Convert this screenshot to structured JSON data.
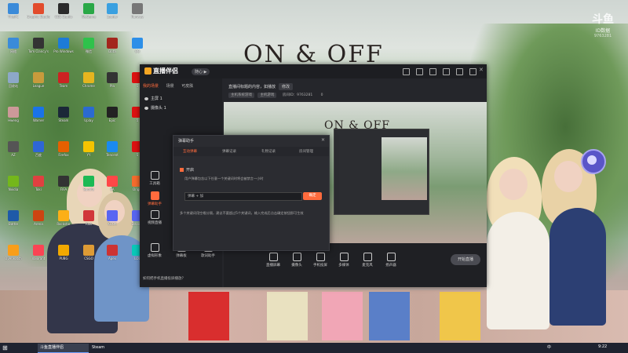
{
  "stream_logo": {
    "name": "斗鱼",
    "line2": "ID数据",
    "line3": "9763281"
  },
  "wallpaper": {
    "title": "ON & OFF"
  },
  "desktop_icons": [
    {
      "label": "ThisPC",
      "color": "#3b8bd9"
    },
    {
      "label": "Graphic Studio",
      "color": "#e24c2c"
    },
    {
      "label": "OBS Studio",
      "color": "#2b2b2b"
    },
    {
      "label": "WeGame",
      "color": "#2aa847"
    },
    {
      "label": "Loader",
      "color": "#3aa0e0"
    },
    {
      "label": "Runway",
      "color": "#777"
    },
    {
      "label": "网络",
      "color": "#3b8bd9"
    },
    {
      "label": "Tom Clancy's",
      "color": "#333"
    },
    {
      "label": "Pro Windows",
      "color": "#1d7bd6"
    },
    {
      "label": "微信",
      "color": "#2fc24b"
    },
    {
      "label": "Dota",
      "color": "#a3261d"
    },
    {
      "label": "QQ",
      "color": "#2d8fe8"
    },
    {
      "label": "回收站",
      "color": "#8da8c8"
    },
    {
      "label": "League",
      "color": "#c89b3c"
    },
    {
      "label": "Team",
      "color": "#c22"
    },
    {
      "label": "Chrome",
      "color": "#e5b51f"
    },
    {
      "label": "Pla",
      "color": "#333"
    },
    {
      "label": "5",
      "color": "#d11"
    },
    {
      "label": "Hweng",
      "color": "#c99"
    },
    {
      "label": "Warner",
      "color": "#1a73e8"
    },
    {
      "label": "Steam",
      "color": "#1b2838"
    },
    {
      "label": "Uplay",
      "color": "#2b6ad1"
    },
    {
      "label": "Epic",
      "color": "#222"
    },
    {
      "label": "5",
      "color": "#d11"
    },
    {
      "label": "AZ",
      "color": "#555"
    },
    {
      "label": "百度",
      "color": "#2e66d6"
    },
    {
      "label": "Firefox",
      "color": "#e66000"
    },
    {
      "label": "YY",
      "color": "#f5c400"
    },
    {
      "label": "Tencent",
      "color": "#1a8af0"
    },
    {
      "label": "5",
      "color": "#d11"
    },
    {
      "label": "Nvidia",
      "color": "#74b71b"
    },
    {
      "label": "Toki",
      "color": "#e04040"
    },
    {
      "label": "FIFA",
      "color": "#333"
    },
    {
      "label": "Spotify",
      "color": "#1db954"
    },
    {
      "label": "EA",
      "color": "#ff4747"
    },
    {
      "label": "Origin",
      "color": "#f56c2d"
    },
    {
      "label": "Battle",
      "color": "#1e5aa8"
    },
    {
      "label": "Arena",
      "color": "#c41"
    },
    {
      "label": "Rockstar",
      "color": "#fcaf17"
    },
    {
      "label": "Riot",
      "color": "#d13639"
    },
    {
      "label": "KOOK",
      "color": "#5865f2"
    },
    {
      "label": "Discord",
      "color": "#5865f2"
    },
    {
      "label": "Overwatch",
      "color": "#f99e1a"
    },
    {
      "label": "Valorant",
      "color": "#fa4454"
    },
    {
      "label": "PUBG",
      "color": "#f2a900"
    },
    {
      "label": "CSGO",
      "color": "#de9b35"
    },
    {
      "label": "Apex",
      "color": "#cd3333"
    },
    {
      "label": "LOL",
      "color": "#0ac8b9"
    }
  ],
  "app": {
    "brand": "直播伴侣",
    "version": "随心 ▶",
    "tabs": [
      "我的场景",
      "场景",
      "可皮肤"
    ],
    "scenes": [
      "主屏 1",
      "摄像头 1"
    ],
    "room_title": "直播间标题的内容，如播放",
    "room_btn": "修改",
    "meta": [
      "主机系统游戏",
      "主机游戏",
      "房间ID：9763281",
      "0"
    ],
    "side_tools": [
      "工具箱",
      "弹幕助手",
      "视频直播",
      "虚拟形象"
    ],
    "bottom_tools": [
      "直播屏幕",
      "摄像头",
      "手机投屏",
      "多媒体",
      "麦克风",
      "扬声器"
    ],
    "extra_tools": [
      "弹幕板",
      "歌词助手",
      "发弹幕助手"
    ],
    "go_live": "开始直播",
    "hint": "如何把手机直播投屏播放？",
    "preview_title": "ON & OFF"
  },
  "dialog": {
    "title": "弹幕助手",
    "close": "✕",
    "tabs": [
      "互动弹幕",
      "弹幕记录",
      "礼物记录",
      "房间管理"
    ],
    "checkbox": "开启",
    "desc": "用户弹幕包含以下任意一个关键词时将会被禁言一小时",
    "input_placeholder": "弹幕 + 加",
    "add_btn": "确定",
    "note": "多个关键词用空格分隔，建议不要超过5个关键词，输入完成后点击确定按钮即可生效"
  },
  "taskbar": {
    "start": "⊞",
    "apps": [
      "斗鱼直播伴侣",
      "Steam"
    ],
    "lang": "中",
    "time": "9:22"
  },
  "colors": {
    "accent": "#ff6b3d",
    "app_bg": "#25262b",
    "taskbar": "#1f2330"
  }
}
